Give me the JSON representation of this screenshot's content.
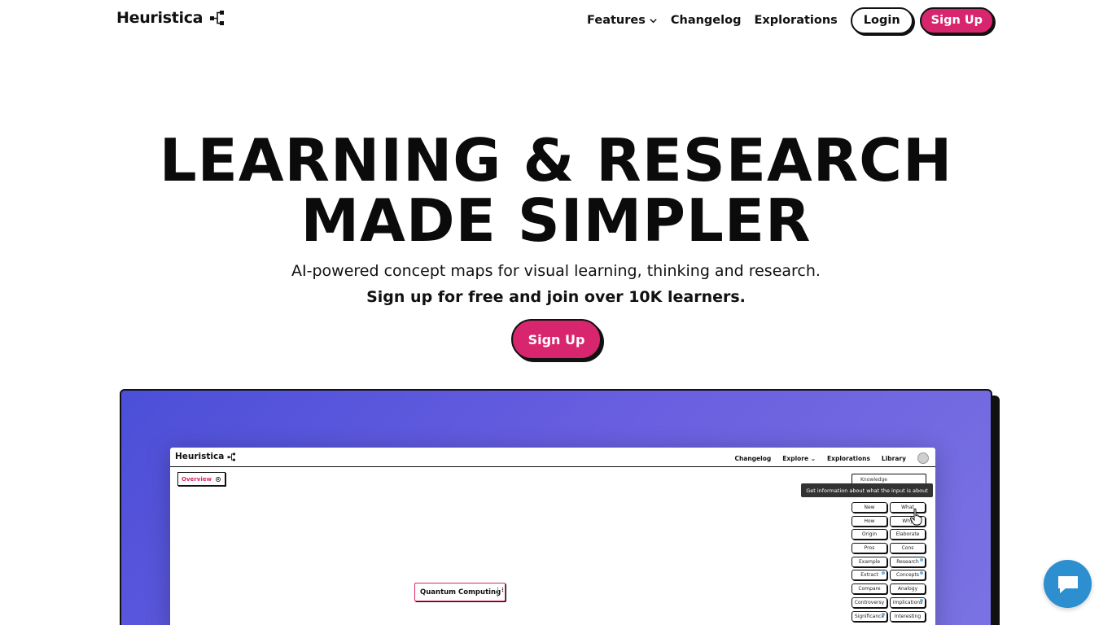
{
  "brand": {
    "name": "Heuristica",
    "accent": "#d8266e",
    "gradient_start": "#4b4fd8",
    "gradient_end": "#7a73e2"
  },
  "nav": {
    "features": "Features",
    "changelog": "Changelog",
    "explorations": "Explorations",
    "login": "Login",
    "signup": "Sign Up"
  },
  "hero": {
    "title_line1": "LEARNING & RESEARCH",
    "title_line2": "MADE SIMPLER",
    "subtitle": "AI-powered concept maps for visual learning, thinking and research.",
    "subtitle_bold": "Sign up for free and join over 10K learners.",
    "cta": "Sign Up"
  },
  "app_preview": {
    "logo": "Heuristica",
    "nav": {
      "changelog": "Changelog",
      "explore": "Explore",
      "explorations": "Explorations",
      "library": "Library"
    },
    "overview": "Overview",
    "select_value": "Knowledge",
    "tooltip": "Get information about what the input is about",
    "actions": [
      {
        "label": "New",
        "dot": false
      },
      {
        "label": "What",
        "dot": false
      },
      {
        "label": "How",
        "dot": false
      },
      {
        "label": "Why",
        "dot": false
      },
      {
        "label": "Origin",
        "dot": false
      },
      {
        "label": "Elaborate",
        "dot": false
      },
      {
        "label": "Pros",
        "dot": false
      },
      {
        "label": "Cons",
        "dot": false
      },
      {
        "label": "Example",
        "dot": false
      },
      {
        "label": "Research",
        "dot": true
      },
      {
        "label": "Extract",
        "dot": true
      },
      {
        "label": "Concepts",
        "dot": true
      },
      {
        "label": "Compare",
        "dot": false
      },
      {
        "label": "Analogy",
        "dot": false
      },
      {
        "label": "Controversy",
        "dot": false
      },
      {
        "label": "Implications",
        "dot": true
      },
      {
        "label": "Significance",
        "dot": true
      },
      {
        "label": "Interesting",
        "dot": false
      }
    ],
    "node": "Quantum Computing"
  }
}
